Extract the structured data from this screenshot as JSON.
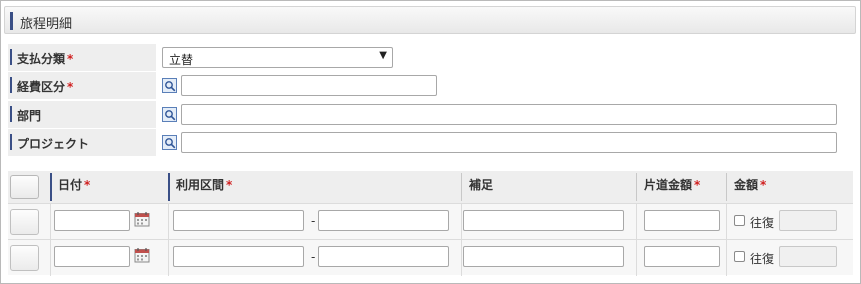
{
  "section": {
    "title": "旅程明細"
  },
  "form": {
    "payment_type": {
      "label": "支払分類",
      "required_mark": "*",
      "value": "立替",
      "caret": "▼"
    },
    "expense_category": {
      "label": "経費区分",
      "required_mark": "*",
      "value": ""
    },
    "department": {
      "label": "部門",
      "value": ""
    },
    "project": {
      "label": "プロジェクト",
      "value": ""
    }
  },
  "grid": {
    "columns": {
      "date": {
        "label": "日付",
        "required_mark": "*"
      },
      "route": {
        "label": "利用区間",
        "required_mark": "*"
      },
      "supplement": {
        "label": "補足"
      },
      "one_way_amount": {
        "label": "片道金額",
        "required_mark": "*"
      },
      "amount": {
        "label": "金額",
        "required_mark": "*"
      }
    },
    "rows": [
      {
        "date": "",
        "from": "",
        "separator": "-",
        "to": "",
        "supplement": "",
        "one_way_amount": "",
        "round_trip_label": "往復",
        "round_trip_checked": false,
        "amount": ""
      },
      {
        "date": "",
        "from": "",
        "separator": "-",
        "to": "",
        "supplement": "",
        "one_way_amount": "",
        "round_trip_label": "往復",
        "round_trip_checked": false,
        "amount": ""
      }
    ]
  },
  "colors": {
    "accent": "#3a4f86",
    "required": "#d02020",
    "label_bg": "#eeeeee"
  }
}
